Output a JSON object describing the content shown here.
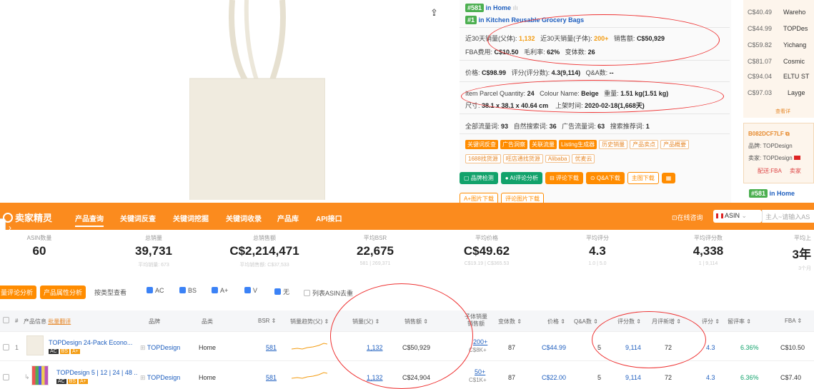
{
  "detail": {
    "rank_home": "#581",
    "rank_home_label": "in Home",
    "rank_kitchen": "#1",
    "rank_kitchen_label": "in Kitchen Reusable Grocery Bags",
    "row1": [
      {
        "label": "近30天销量(父体):",
        "value": "1,132"
      },
      {
        "label": "近30天销量(子体):",
        "value": "200+"
      },
      {
        "label": "销售额:",
        "value": "C$50,929"
      }
    ],
    "row2": [
      {
        "label": "FBA费用:",
        "value": "C$10.50"
      },
      {
        "label": "毛利率:",
        "value": "62%"
      },
      {
        "label": "变体数:",
        "value": "26"
      }
    ],
    "row3": [
      {
        "label": "价格:",
        "value": "C$98.99"
      },
      {
        "label": "评分(评分数):",
        "value": "4.3(9,114)"
      },
      {
        "label": "Q&A数:",
        "value": "--"
      }
    ],
    "row4": [
      {
        "label": "Item Parcel Quantity:",
        "value": "24"
      },
      {
        "label": "Colour Name:",
        "value": "Beige"
      },
      {
        "label": "重量:",
        "value": "1.51 kg(1.51 kg)"
      }
    ],
    "row5": [
      {
        "label": "尺寸:",
        "value": "38.1 x 38.1 x 40.64 cm"
      },
      {
        "label": "上架时间:",
        "value": "2020-02-18(1,668天)"
      }
    ],
    "row6": [
      {
        "label": "全部流量词:",
        "value": "93"
      },
      {
        "label": "自然搜索词:",
        "value": "36"
      },
      {
        "label": "广告流量词:",
        "value": "63"
      },
      {
        "label": "搜索推荐词:",
        "value": "1"
      }
    ],
    "tags_orange": [
      "关键词反查",
      "广告洞察",
      "关联流量",
      "Listing生成器"
    ],
    "tags_light": [
      "历史销量",
      "产品卖点",
      "产品概要"
    ],
    "tags_light2": [
      "1688找货源",
      "旺店通找货源",
      "Alibaba",
      "优麦云"
    ],
    "buttons": [
      "品牌检测",
      "AI评论分析",
      "评论下载",
      "Q&A下载",
      "主图下载"
    ],
    "buttons2": [
      "A+图片下载",
      "评论图片下载"
    ]
  },
  "right_panel": {
    "rows": [
      {
        "price": "C$40.49",
        "name": "Wareho"
      },
      {
        "price": "C$44.99",
        "name": "TOPDes"
      },
      {
        "price": "C$59.82",
        "name": "Yichang"
      },
      {
        "price": "C$81.07",
        "name": "Cosmic"
      },
      {
        "price": "C$94.04",
        "name": "ELTU ST"
      },
      {
        "price": "C$97.03",
        "name": "Layge"
      }
    ],
    "more": "查看详",
    "card_asin": "B082DCF7LF",
    "card_brand": "品牌: TOPDesign",
    "card_seller": "卖家: TOPDesign",
    "card_fba": "配送:FBA",
    "card_seller2": "卖家",
    "card_rank": "#581",
    "card_rank_label": "in Home"
  },
  "nav": {
    "logo": "卖家精灵",
    "items": [
      "产品查询",
      "关键词反查",
      "关键词挖掘",
      "关键词收录",
      "产品库",
      "API接口"
    ],
    "online_service": "在线咨询",
    "country": "ASIN",
    "search_placeholder": "主人~请输入AS"
  },
  "stats": [
    {
      "label": "ASIN数量",
      "value": "60",
      "sub": ""
    },
    {
      "label": "总销量",
      "value": "39,731",
      "sub": "平均销量: 673"
    },
    {
      "label": "总销售额",
      "value": "C$2,214,471",
      "sub": "平均销售额: C$37,533"
    },
    {
      "label": "平均BSR",
      "value": "22,675",
      "sub": "581 | 269,371"
    },
    {
      "label": "平均价格",
      "value": "C$49.62",
      "sub": "C$19.19 | C$365.53"
    },
    {
      "label": "平均评分",
      "value": "4.3",
      "sub": "1.0 | 5.0"
    },
    {
      "label": "平均评分数",
      "value": "4,338",
      "sub": "1 | 9,114"
    },
    {
      "label": "平均上",
      "value": "3年",
      "sub": "3个月"
    }
  ],
  "filters": {
    "btn1": "量评论分析",
    "btn2": "产品属性分析",
    "group_label": "按类型查看",
    "checks": [
      "AC",
      "BS",
      "A+",
      "V",
      "无"
    ],
    "dedupe": "列表ASIN去重"
  },
  "table": {
    "headers": [
      "#",
      "产品信息",
      "品牌",
      "品类",
      "BSR",
      "销量趋势(父)",
      "销量(父)",
      "销售额",
      "子体销量",
      "销售额",
      "变体数",
      "价格",
      "Q&A数",
      "评分数",
      "月评新增",
      "评分",
      "留评率",
      "FBA"
    ],
    "sort_link": "批量翻译",
    "rows": [
      {
        "idx": "1",
        "title": "TOPDesign 24-Pack Econo...",
        "brand": "TOPDesign",
        "cat": "Home",
        "bsr": "581",
        "sales": "1,132",
        "revenue": "C$50,929",
        "child_sales": "200+",
        "child_rev": "C$8K+",
        "variants": "87",
        "price": "C$44.99",
        "qa": "5",
        "reviews": "9,114",
        "monthly": "72",
        "rating": "4.3",
        "rate": "6.36%",
        "fba": "C$10.50"
      },
      {
        "idx": "",
        "title": "TOPDesign 5 | 12 | 24 | 48 ..",
        "brand": "TOPDesign",
        "cat": "Home",
        "bsr": "581",
        "sales": "1,132",
        "revenue": "C$24,904",
        "child_sales": "50+",
        "child_rev": "C$1K+",
        "variants": "87",
        "price": "C$22.00",
        "qa": "5",
        "reviews": "9,114",
        "monthly": "72",
        "rating": "4.3",
        "rate": "6.36%",
        "fba": "C$7.40"
      }
    ],
    "badges": [
      "AC",
      "BS",
      "A+"
    ]
  },
  "colors": {
    "nav": "#fb8b1e",
    "accent": "#ff8c00",
    "link": "#1f5fbf",
    "green": "#12a26b",
    "annotation": "#e33"
  }
}
